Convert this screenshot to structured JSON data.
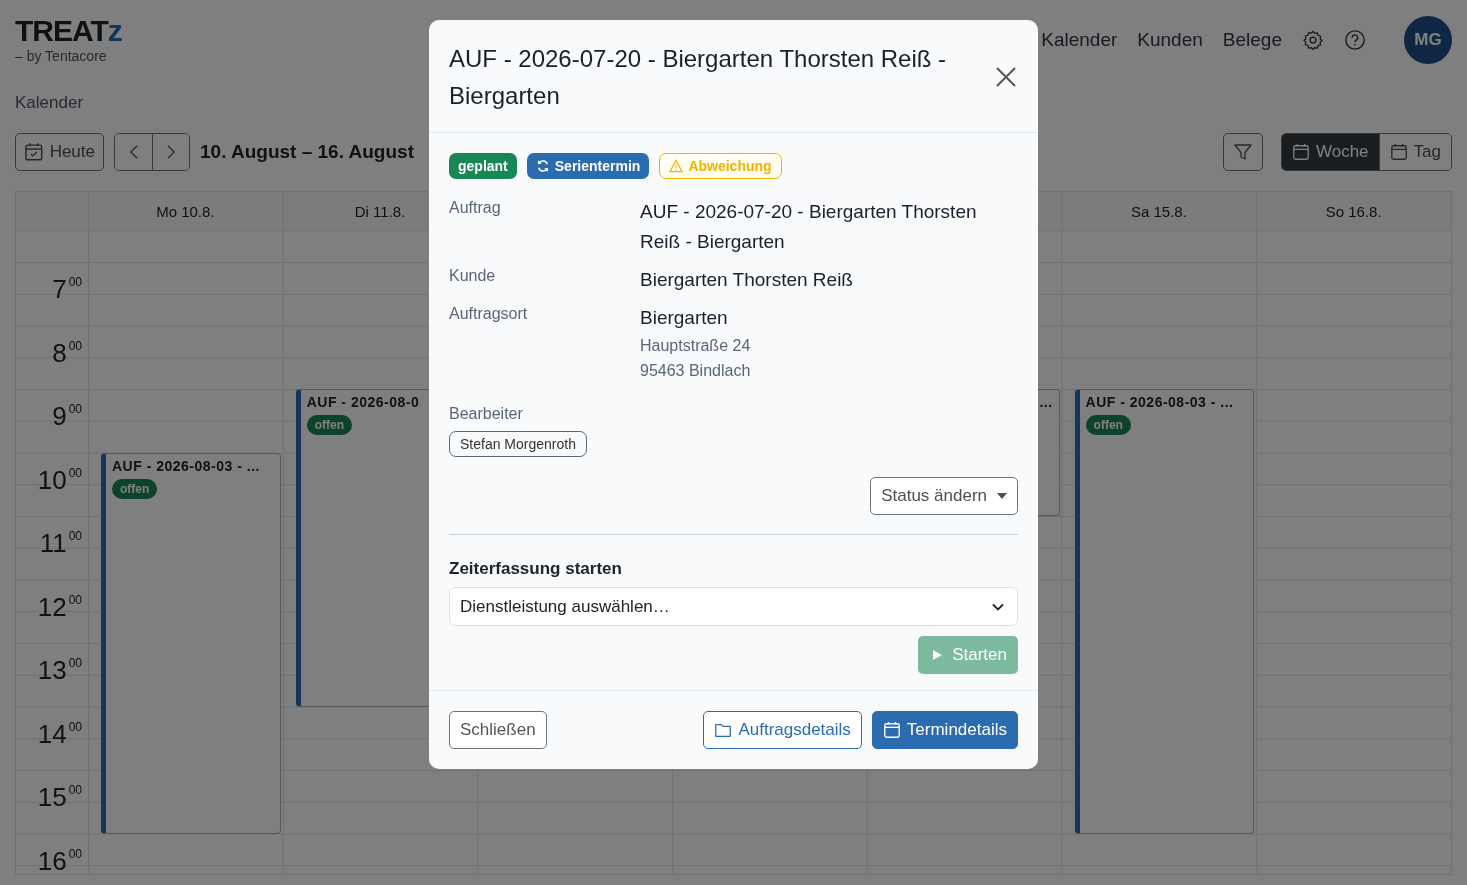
{
  "logo": {
    "main": "TREAT",
    "accent": "z",
    "tagline": "– by Tentacore"
  },
  "nav": [
    {
      "label": "Kalender"
    },
    {
      "label": "Kunden"
    },
    {
      "label": "Belege"
    }
  ],
  "avatar": "MG",
  "page_title": "Kalender",
  "toolbar": {
    "today": "Heute",
    "range": "10. August – 16. August",
    "views": [
      {
        "label": "Woche",
        "selected": true
      },
      {
        "label": "Tag",
        "selected": false
      }
    ]
  },
  "calendar": {
    "days": [
      {
        "label": "Mo 10.8.",
        "events": [
          {
            "title": "AUF - 2026-08-03 - ...",
            "status": "offen"
          }
        ]
      },
      {
        "label": "Di 11.8.",
        "events": [
          {
            "title": "AUF - 2026-08-0",
            "status": "offen"
          }
        ]
      },
      {
        "events": [
          {
            "title": "..."
          }
        ]
      },
      {
        "label": "Sa 15.8.",
        "events": [
          {
            "title": "AUF - 2026-08-03 - ...",
            "status": "offen"
          }
        ]
      },
      {
        "label": "So 16.8."
      }
    ],
    "hours": [
      {
        "hour": "7",
        "minutes": "00"
      },
      {
        "hour": "8",
        "minutes": "00"
      },
      {
        "hour": "9",
        "minutes": "00"
      },
      {
        "hour": "10",
        "minutes": "00"
      },
      {
        "hour": "11",
        "minutes": "00"
      },
      {
        "hour": "12",
        "minutes": "00"
      },
      {
        "hour": "13",
        "minutes": "00"
      },
      {
        "hour": "14",
        "minutes": "00"
      },
      {
        "hour": "15",
        "minutes": "00"
      },
      {
        "hour": "16",
        "minutes": "00"
      }
    ]
  },
  "dialog": {
    "title": "AUF - 2026-07-20 - Biergarten Thorsten Reiß - Biergarten",
    "badges": [
      {
        "label": "geplant",
        "kind": "status",
        "color": "#198754"
      },
      {
        "label": "Serientermin",
        "kind": "series",
        "color": "#2b6cb0"
      },
      {
        "label": "Abweichung",
        "kind": "deviation",
        "color": "#f0b400"
      }
    ],
    "details": [
      {
        "label": "Auftrag",
        "value": "AUF - 2026-07-20 - Biergarten Thorsten Reiß - Biergarten"
      },
      {
        "label": "Kunde",
        "value": "Biergarten Thorsten Reiß"
      },
      {
        "label": "Auftragsort",
        "value": "Biergarten",
        "lines": [
          "Hauptstraße 24",
          "95463 Bindlach"
        ]
      }
    ],
    "assignee_label": "Bearbeiter",
    "assignees": [
      "Stefan Morgenroth"
    ],
    "status_button": "Status ändern",
    "time_tracking": {
      "heading": "Zeiterfassung starten",
      "select": "Dienstleistung auswählen…",
      "start": "Starten",
      "disabled": true
    },
    "footer": {
      "close": "Schließen",
      "order_details": "Auftragsdetails",
      "appointment_details": "Termindetails"
    }
  }
}
